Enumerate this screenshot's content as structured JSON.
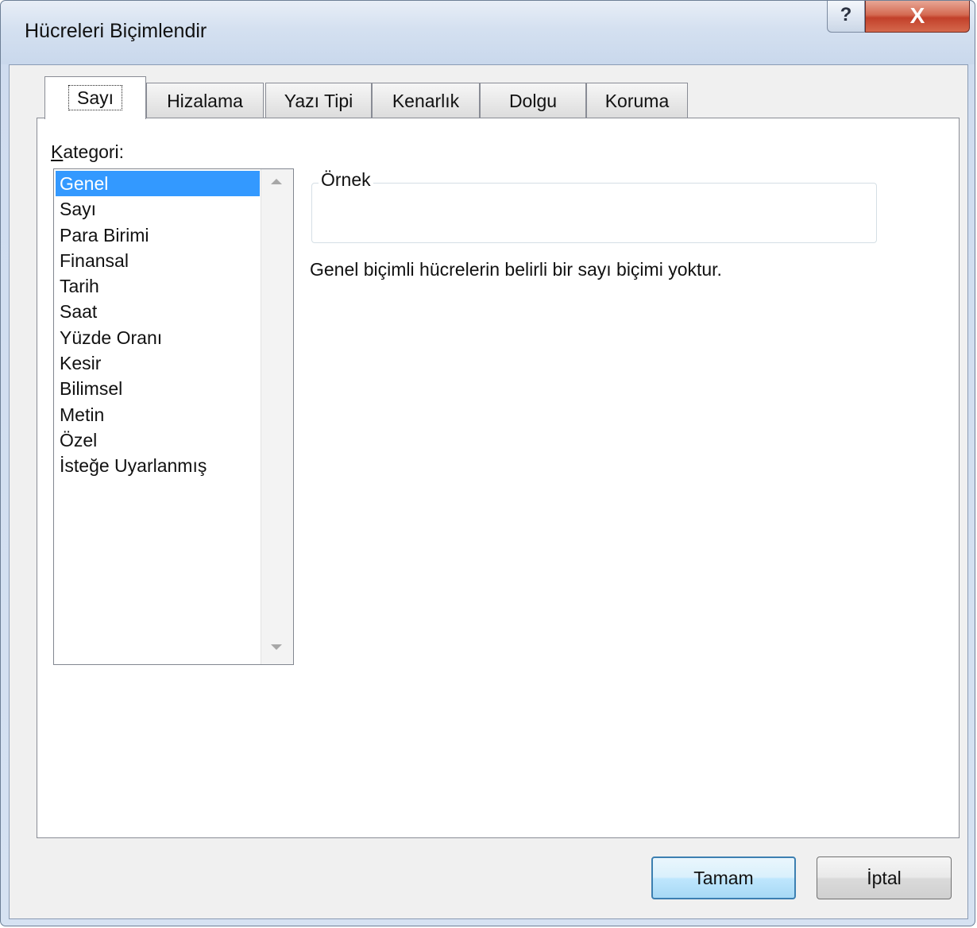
{
  "window": {
    "title": "Hücreleri Biçimlendir",
    "help_glyph": "?",
    "close_glyph": "X"
  },
  "tabs": [
    {
      "label": "Sayı",
      "active": true
    },
    {
      "label": "Hizalama",
      "active": false
    },
    {
      "label": "Yazı Tipi",
      "active": false
    },
    {
      "label": "Kenarlık",
      "active": false
    },
    {
      "label": "Dolgu",
      "active": false
    },
    {
      "label": "Koruma",
      "active": false
    }
  ],
  "category": {
    "label_access_key": "K",
    "label_rest": "ategori:",
    "items": [
      "Genel",
      "Sayı",
      "Para Birimi",
      "Finansal",
      "Tarih",
      "Saat",
      "Yüzde Oranı",
      "Kesir",
      "Bilimsel",
      "Metin",
      "Özel",
      "İsteğe Uyarlanmış"
    ],
    "selected": "Genel"
  },
  "sample": {
    "legend": "Örnek",
    "value": ""
  },
  "description": "Genel biçimli hücrelerin belirli bir sayı biçimi yoktur.",
  "buttons": {
    "ok_label": "Tamam",
    "cancel_label": "İptal"
  },
  "colors": {
    "selection": "#3399ff",
    "close_button": "#c2402a",
    "default_button_border": "#3c7fb1"
  }
}
